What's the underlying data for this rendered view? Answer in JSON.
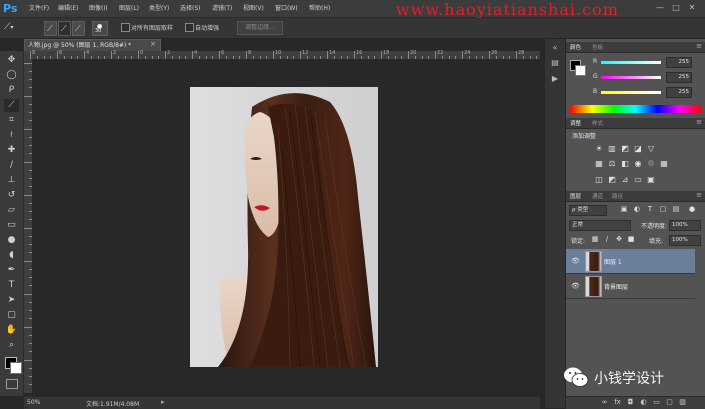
{
  "app": {
    "logo": "Ps"
  },
  "menu": [
    "文件(F)",
    "编辑(E)",
    "图像(I)",
    "图层(L)",
    "类型(Y)",
    "选择(S)",
    "滤镜(T)",
    "视图(V)",
    "窗口(W)",
    "帮助(H)"
  ],
  "watermark": "www.haoyiatianshai.com",
  "window_controls": [
    "—",
    "□",
    "✕"
  ],
  "options": {
    "brush_size": "30",
    "sample_all_layers_label": "对所有图层取样",
    "auto_enhance_label": "自动增强",
    "refine_edge_label": "调整边缘..."
  },
  "document": {
    "tab_title": "人物.jpg @ 50% (图层 1, RGB/8#) *",
    "close": "×"
  },
  "ruler": {
    "top_numbers": [
      "8",
      "6",
      "4",
      "2",
      "0",
      "2",
      "4",
      "6",
      "8",
      "10",
      "12",
      "14",
      "16",
      "18",
      "20",
      "22",
      "24",
      "26",
      "28"
    ],
    "left_numbers": [
      "0",
      "2",
      "4",
      "6",
      "8",
      "10",
      "12",
      "14",
      "16",
      "18"
    ]
  },
  "tools": [
    "move-tool",
    "marquee-tool",
    "lasso-tool",
    "quick-select-tool",
    "crop-tool",
    "eyedropper-tool",
    "healing-tool",
    "brush-tool",
    "stamp-tool",
    "history-brush-tool",
    "eraser-tool",
    "gradient-tool",
    "blur-tool",
    "dodge-tool",
    "pen-tool",
    "type-tool",
    "path-select-tool",
    "shape-tool",
    "hand-tool",
    "zoom-tool"
  ],
  "status": {
    "zoom": "50%",
    "doc_info": "文档:1.91M/4.08M"
  },
  "color_panel": {
    "tabs": [
      "颜色",
      "色板"
    ],
    "r_label": "R",
    "g_label": "G",
    "b_label": "B",
    "r_value": "255",
    "g_value": "255",
    "b_value": "255",
    "fg_color": "#000000",
    "bg_color": "#ffffff"
  },
  "adjustments_panel": {
    "tabs": [
      "调整",
      "样式"
    ],
    "title": "添加调整"
  },
  "layers_panel": {
    "tabs": [
      "图层",
      "通道",
      "路径"
    ],
    "filter_label": "ρ 类型",
    "blend_mode": "正常",
    "opacity_label": "不透明度:",
    "opacity_value": "100%",
    "lock_label": "锁定:",
    "fill_label": "填充:",
    "fill_value": "100%",
    "layers": [
      {
        "name": "图层 1",
        "selected": true
      },
      {
        "name": "背景图层",
        "selected": false
      }
    ]
  },
  "layers_bottom_icons": [
    "link-icon",
    "fx-icon",
    "mask-icon",
    "adjustment-icon",
    "folder-icon",
    "new-layer-icon",
    "trash-icon"
  ],
  "wechat": {
    "text": "小钱学设计"
  }
}
